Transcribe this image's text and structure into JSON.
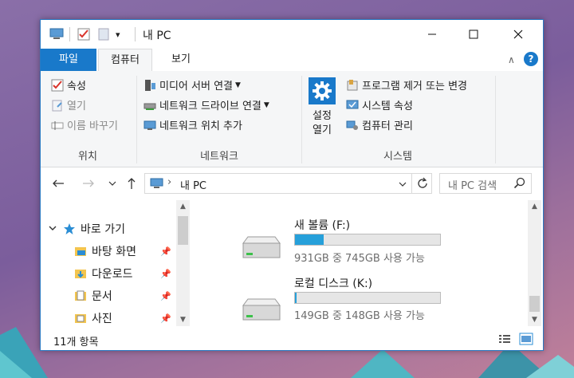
{
  "window": {
    "title": "내 PC",
    "qa_dropdown": "▾"
  },
  "tabs": {
    "file": "파일",
    "computer": "컴퓨터",
    "view": "보기"
  },
  "ribbon": {
    "location": {
      "label": "위치",
      "items": {
        "properties": "속성",
        "open": "열기",
        "rename": "이름 바꾸기"
      }
    },
    "network": {
      "label": "네트워크",
      "items": {
        "media_server": "미디어 서버 연결",
        "map_drive": "네트워크 드라이브 연결",
        "add_location": "네트워크 위치 추가"
      }
    },
    "system": {
      "label": "시스템",
      "settings_line1": "설정",
      "settings_line2": "열기",
      "items": {
        "uninstall": "프로그램 제거 또는 변경",
        "sys_props": "시스템 속성",
        "manage": "컴퓨터 관리"
      }
    }
  },
  "address": {
    "path": "내 PC",
    "search_placeholder": "내 PC 검색"
  },
  "nav": {
    "quick_access": "바로 가기",
    "items": [
      {
        "label": "바탕 화면"
      },
      {
        "label": "다운로드"
      },
      {
        "label": "문서"
      },
      {
        "label": "사진"
      }
    ]
  },
  "drives": [
    {
      "name": "새 볼륨 (F:)",
      "info": "931GB 중 745GB 사용 가능",
      "used_fraction": 0.2
    },
    {
      "name": "로컬 디스크 (K:)",
      "info": "149GB 중 148GB 사용 가능",
      "used_fraction": 0.01
    }
  ],
  "status": {
    "count": "11개 항목"
  },
  "colors": {
    "accent": "#1979ca",
    "drive_fill": "#26a0da",
    "folder": "#f3c54f"
  }
}
